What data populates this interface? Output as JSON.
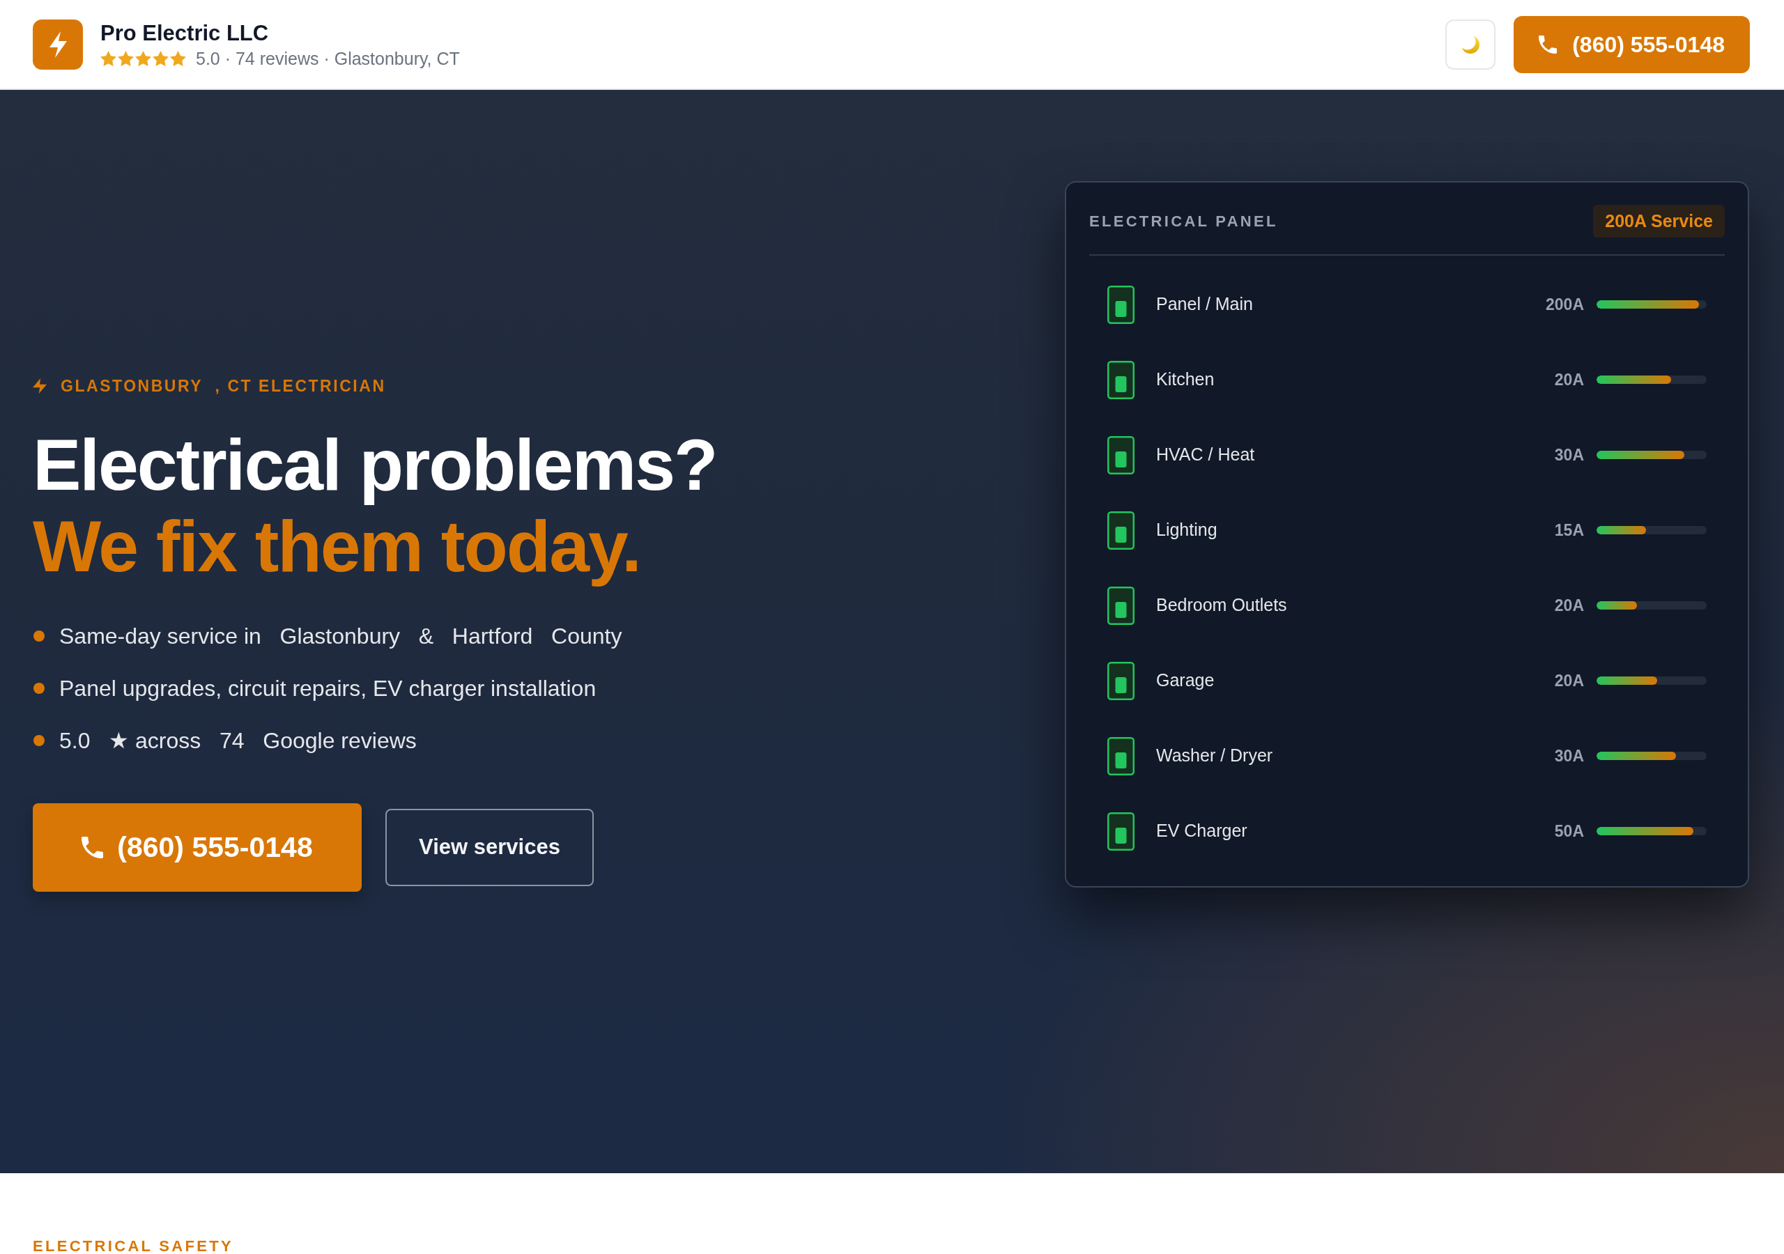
{
  "header": {
    "business_name": "Pro Electric LLC",
    "stars": 5,
    "rating_summary": "5.0 · 74 reviews · Glastonbury, CT",
    "phone_button": "(860) 555-0148"
  },
  "hero": {
    "eyebrow": "GLASTONBURY  , CT ELECTRICIAN",
    "headline": "Electrical problems?",
    "headline_accent": "We fix them today.",
    "bullets": [
      "Same-day service in   Glastonbury   &   Hartford   County",
      "Panel upgrades, circuit repairs, EV charger installation",
      "5.0   ★ across   74   Google reviews"
    ],
    "primary_button": "(860) 555-0148",
    "secondary_button": "View services"
  },
  "panel": {
    "title": "ELECTRICAL PANEL",
    "badge": "200A Service",
    "circuits": [
      {
        "name": "Panel / Main",
        "amps": "200A",
        "on": true,
        "level": 0.93
      },
      {
        "name": "Kitchen",
        "amps": "20A",
        "on": true,
        "level": 0.68
      },
      {
        "name": "HVAC / Heat",
        "amps": "30A",
        "on": true,
        "level": 0.8
      },
      {
        "name": "Lighting",
        "amps": "15A",
        "on": true,
        "level": 0.45
      },
      {
        "name": "Bedroom Outlets",
        "amps": "20A",
        "on": true,
        "level": 0.37
      },
      {
        "name": "Garage",
        "amps": "20A",
        "on": true,
        "level": 0.55
      },
      {
        "name": "Washer / Dryer",
        "amps": "30A",
        "on": true,
        "level": 0.72
      },
      {
        "name": "EV Charger",
        "amps": "50A",
        "on": true,
        "level": 0.88
      }
    ]
  },
  "next_section": {
    "eyebrow": "ELECTRICAL SAFETY"
  }
}
